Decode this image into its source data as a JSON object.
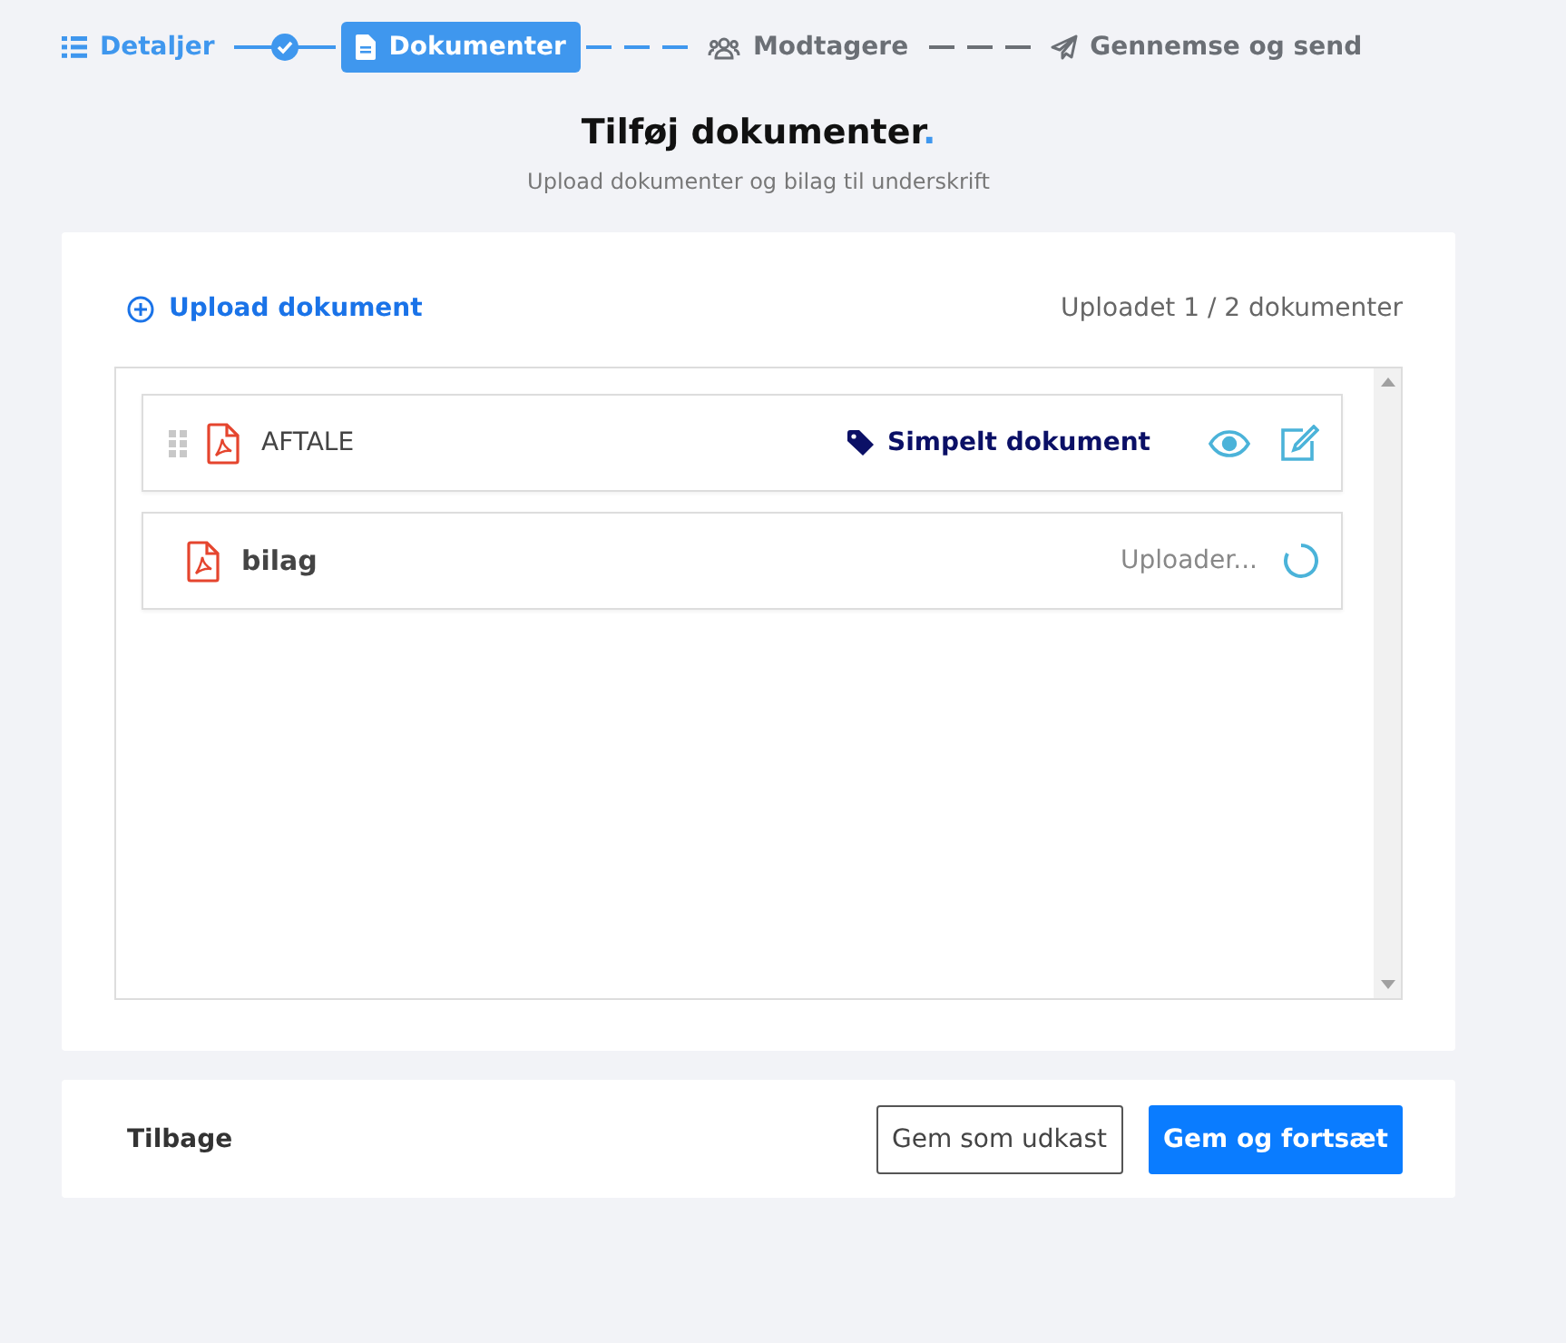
{
  "steps": [
    {
      "label": "Detaljer",
      "kind": "list",
      "completed": true,
      "selected": false
    },
    {
      "label": "Dokumenter",
      "kind": "file",
      "completed": false,
      "selected": true
    },
    {
      "label": "Modtagere",
      "kind": "users",
      "completed": false,
      "selected": false
    },
    {
      "label": "Gennemse og send",
      "kind": "send",
      "completed": false,
      "selected": false
    }
  ],
  "heading": {
    "title": "Tilføj dokumenter",
    "accent": ".",
    "subtitle": "Upload dokumenter og bilag til underskrift"
  },
  "upload_link": "Upload dokument",
  "upload_count": "Uploadet 1 / 2 dokumenter",
  "documents": [
    {
      "name": "AFTALE",
      "kind": "ready",
      "tag": "Simpelt dokument"
    },
    {
      "name": "bilag",
      "kind": "uploading",
      "status": "Uploader..."
    }
  ],
  "footer": {
    "back": "Tilbage",
    "draft": "Gem som udkast",
    "next": "Gem og fortsæt"
  }
}
